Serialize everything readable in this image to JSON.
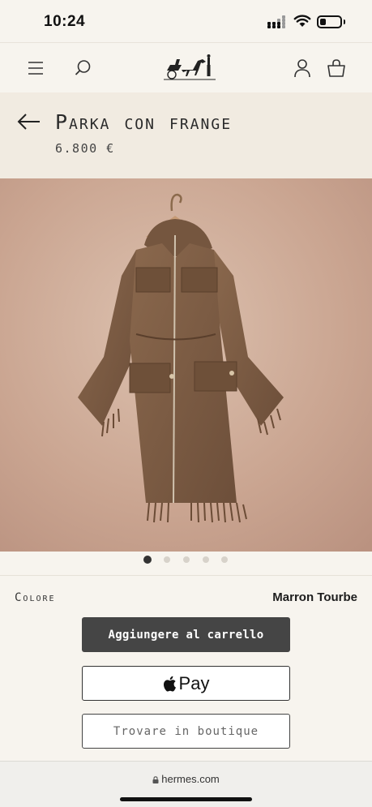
{
  "status_bar": {
    "time": "10:24",
    "battery_level": 0.3
  },
  "header": {
    "icons": [
      "menu-icon",
      "search-icon",
      "hermes-logo",
      "account-icon",
      "bag-icon"
    ]
  },
  "product": {
    "title": "Parka con frange",
    "price": "6.800 €",
    "image": {
      "subject": "brown wool hooded parka with fringed hems on a hanger"
    }
  },
  "gallery": {
    "total_images": 5,
    "active_index": 0
  },
  "color": {
    "label": "Colore",
    "value": "Marron Tourbe"
  },
  "actions": {
    "add_to_cart": "Aggiungere al carrello",
    "apple_pay": "Pay",
    "find_in_boutique": "Trovare in boutique"
  },
  "browser": {
    "url": "hermes.com"
  },
  "colors": {
    "background": "#f7f4ee",
    "title_band": "#f1ebe1",
    "cart_button": "#454545",
    "garment": "#7a5a41"
  }
}
